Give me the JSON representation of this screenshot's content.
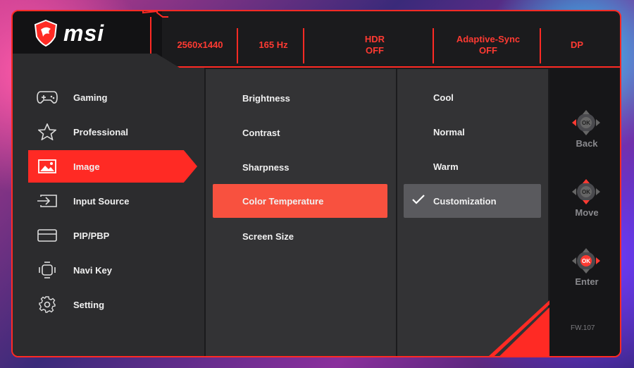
{
  "brand": {
    "name": "msi",
    "accent": "#ff2a24"
  },
  "status": {
    "resolution": "2560x1440",
    "refresh": "165 Hz",
    "hdr_title": "HDR",
    "hdr_value": "OFF",
    "adaptive_title": "Adaptive-Sync",
    "adaptive_value": "OFF",
    "input": "DP"
  },
  "main_menu": {
    "items": [
      {
        "label": "Gaming",
        "icon": "gamepad-icon"
      },
      {
        "label": "Professional",
        "icon": "star-icon"
      },
      {
        "label": "Image",
        "icon": "image-icon",
        "active": true
      },
      {
        "label": "Input Source",
        "icon": "input-source-icon"
      },
      {
        "label": "PIP/PBP",
        "icon": "pip-icon"
      },
      {
        "label": "Navi Key",
        "icon": "navi-key-icon"
      },
      {
        "label": "Setting",
        "icon": "gear-icon"
      }
    ]
  },
  "sub_menu": {
    "items": [
      {
        "label": "Brightness"
      },
      {
        "label": "Contrast"
      },
      {
        "label": "Sharpness"
      },
      {
        "label": "Color Temperature",
        "active": true
      },
      {
        "label": "Screen Size"
      }
    ]
  },
  "options": {
    "items": [
      {
        "label": "Cool"
      },
      {
        "label": "Normal"
      },
      {
        "label": "Warm"
      },
      {
        "label": "Customization",
        "selected": true
      }
    ]
  },
  "nav": {
    "ok_label": "OK",
    "back": "Back",
    "move": "Move",
    "enter": "Enter"
  },
  "firmware": "FW.107"
}
